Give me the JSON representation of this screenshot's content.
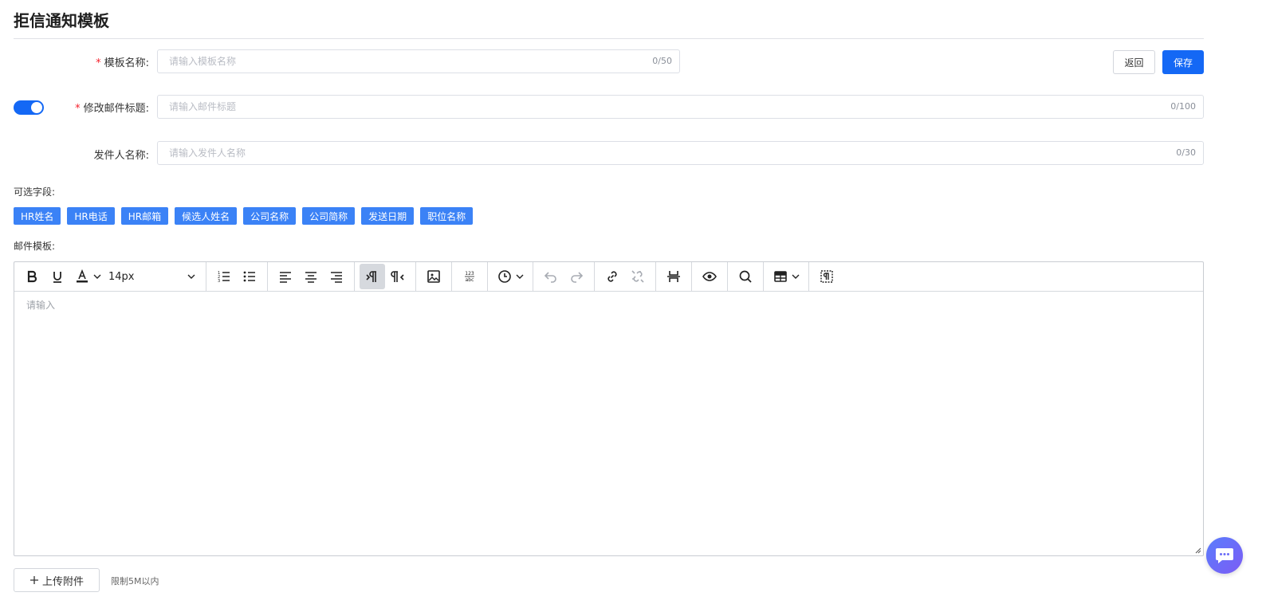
{
  "page": {
    "title": "拒信通知模板"
  },
  "form": {
    "template_name": {
      "label": "模板名称:",
      "placeholder": "请输入模板名称",
      "value": "",
      "counter": "0/50"
    },
    "subject": {
      "label": "修改邮件标题:",
      "placeholder": "请输入邮件标题",
      "value": "",
      "counter": "0/100",
      "toggle_on": true
    },
    "sender": {
      "label": "发件人名称:",
      "placeholder": "请输入发件人名称",
      "value": "",
      "counter": "0/30"
    }
  },
  "actions": {
    "back_label": "返回",
    "save_label": "保存"
  },
  "optional_fields": {
    "label": "可选字段:",
    "items": [
      "HR姓名",
      "HR电话",
      "HR邮箱",
      "候选人姓名",
      "公司名称",
      "公司简称",
      "发送日期",
      "职位名称"
    ]
  },
  "editor": {
    "label": "邮件模板:",
    "font_size": "14px",
    "placeholder": "请输入",
    "toolbar_icons": [
      "bold-icon",
      "underline-icon",
      "font-color-icon",
      "ordered-list-icon",
      "bullet-list-icon",
      "align-left-icon",
      "align-center-icon",
      "align-right-icon",
      "ltr-icon",
      "rtl-icon",
      "image-icon",
      "word-count-icon",
      "insert-datetime-icon",
      "undo-icon",
      "redo-icon",
      "link-icon",
      "unlink-icon",
      "page-break-icon",
      "preview-icon",
      "search-icon",
      "table-icon",
      "visual-blocks-icon"
    ]
  },
  "attachment": {
    "upload_label": "上传附件",
    "hint": "限制5M以内"
  },
  "colors": {
    "primary": "#1468f5",
    "chip": "#3b82f6",
    "required": "#f5222d"
  }
}
